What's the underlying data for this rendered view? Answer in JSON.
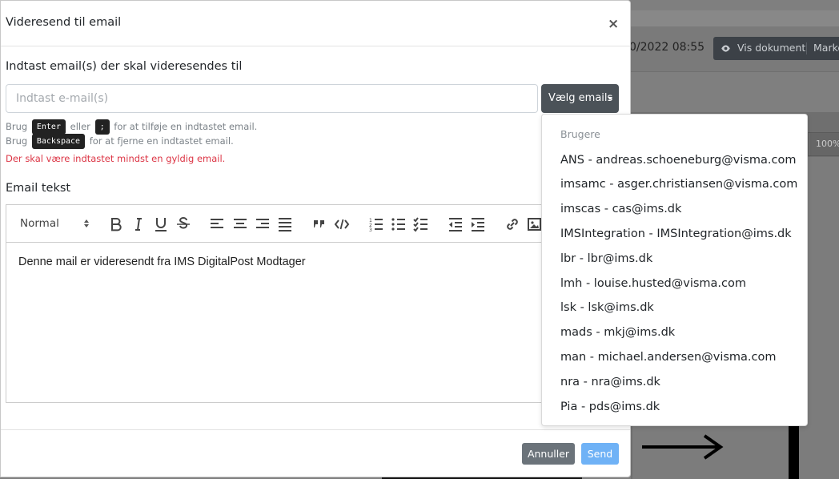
{
  "background": {
    "date_text": "0/2022 08:55",
    "view_doc_label": "Vis dokument",
    "mark_label": "Marke",
    "zoom_label": "100%"
  },
  "modal": {
    "title": "Videresend til email",
    "close_symbol": "×",
    "recipients_label": "Indtast email(s) der skal videresendes til",
    "email_placeholder": "Indtast e-mail(s)",
    "email_value": "",
    "select_emails_label": "Vælg emails",
    "help": {
      "line1_prefix": "Brug",
      "key_enter": "Enter",
      "line1_middle": "eller",
      "key_semicolon": ";",
      "line1_suffix": "for at tilføje en indtastet email.",
      "line2_prefix": "Brug",
      "key_backspace": "Backspace",
      "line2_suffix": "for at fjerne en indtastet email."
    },
    "error_text": "Der skal være indtastet mindst en gyldig email.",
    "email_text_label": "Email tekst",
    "editor": {
      "format_select": "Normal",
      "toolbar_buttons": [
        "bold-icon",
        "italic-icon",
        "underline-icon",
        "strike-icon",
        "align-left-icon",
        "align-center-icon",
        "align-right-icon",
        "align-justify-icon",
        "blockquote-icon",
        "code-icon",
        "ordered-list-icon",
        "bullet-list-icon",
        "check-list-icon",
        "outdent-icon",
        "indent-icon",
        "link-icon",
        "image-icon"
      ],
      "content": "Denne mail er videresendt fra IMS DigitalPost Modtager"
    },
    "cancel_label": "Annuller",
    "send_label": "Send"
  },
  "dropdown": {
    "header": "Brugere",
    "items": [
      "ANS - andreas.schoeneburg@visma.com",
      "imsamc - asger.christiansen@visma.com",
      "imscas - cas@ims.dk",
      "IMSIntegration - IMSIntegration@ims.dk",
      "lbr - lbr@ims.dk",
      "lmh - louise.husted@visma.com",
      "lsk - lsk@ims.dk",
      "mads - mkj@ims.dk",
      "man - michael.andersen@visma.com",
      "nra - nra@ims.dk",
      "Pia - pds@ims.dk"
    ]
  },
  "colors": {
    "primary_disabled": "#6fb2f6",
    "secondary": "#6b737a",
    "danger": "#dc3545",
    "dark_button": "#4b5258"
  }
}
